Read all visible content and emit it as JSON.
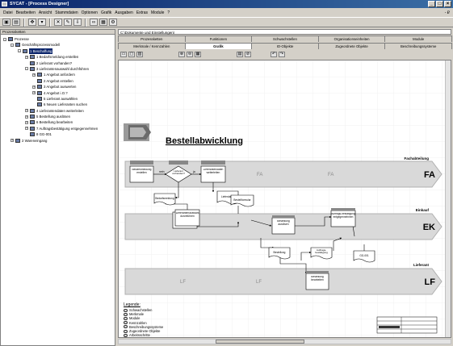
{
  "window": {
    "title": "SYCAT - [Process Designer]"
  },
  "menu": [
    "Datei",
    "Bearbeiten",
    "Ansicht",
    "Stammdaten",
    "Optionen",
    "Grafik",
    "Ausgaben",
    "Extras",
    "Module",
    "?"
  ],
  "menu_right": "- ₽",
  "left_pane": {
    "header": "Prozessketten",
    "tree": [
      {
        "label": "Prozesse",
        "level": 0,
        "box": "-"
      },
      {
        "label": "Geschäftsprozessmodell",
        "level": 1,
        "box": "-"
      },
      {
        "label": "1 Beschaffung",
        "level": 2,
        "box": "-",
        "selected": true
      },
      {
        "label": "1 Bedarfsmeldung erstellen",
        "level": 3,
        "box": "+"
      },
      {
        "label": "2 Lieferant vorhanden?",
        "level": 3,
        "box": ""
      },
      {
        "label": "3 Lieferantenauswahl durchführen",
        "level": 3,
        "box": "-"
      },
      {
        "label": "1 Angebot anfordern",
        "level": 4,
        "box": "+"
      },
      {
        "label": "2 Angebot erstellen",
        "level": 4,
        "box": ""
      },
      {
        "label": "3 Angebot auswerten",
        "level": 4,
        "box": "+"
      },
      {
        "label": "4 Angebot i.O.?",
        "level": 4,
        "box": "+"
      },
      {
        "label": "5 Lieferant auswählen",
        "level": 4,
        "box": ""
      },
      {
        "label": "6 Neuen Lieferanten suchen",
        "level": 4,
        "box": ""
      },
      {
        "label": "4 Lieferantendaten weiterleiten",
        "level": 3,
        "box": "+"
      },
      {
        "label": "5 Bestellung auslösen",
        "level": 3,
        "box": "+"
      },
      {
        "label": "6 Bestellung bearbeiten",
        "level": 3,
        "box": "+"
      },
      {
        "label": "7 Auftragsbestätigung entgegennehmen",
        "level": 3,
        "box": "+"
      },
      {
        "label": "8 GG-001",
        "level": 3,
        "box": ""
      },
      {
        "label": "2 Wareneingang",
        "level": 1,
        "box": "+"
      }
    ]
  },
  "path": "C:\\Dokumente und Einstellungen\\",
  "tabs_row1": [
    "Prozessketten",
    "Funktionen",
    "Schwachstellen",
    "Organisationseinheiten",
    "Module"
  ],
  "tabs_row2": [
    "Merkmale / Kennzahlen",
    "Grafik",
    "IO-Objekte",
    "Zugeordnete Objekte",
    "Beschreibungssysteme"
  ],
  "active_tab": "Grafik",
  "diagram": {
    "title": "Bestellabwicklung",
    "lanes": [
      {
        "name": "Fachabteilung",
        "code": "FA",
        "ghost": [
          "FA",
          "FA"
        ]
      },
      {
        "name": "Einkauf",
        "code": "EK",
        "ghost": []
      },
      {
        "name": "Lieferant",
        "code": "LF",
        "ghost": [
          "LF",
          "LF"
        ]
      }
    ],
    "boxes": {
      "bedarf": "Bedarfsmeldung erstellen",
      "liefvorh": "Lieferant vorhanden?",
      "liefdaten": "Lieferantendaten weiterleiten",
      "bestellung_ausl": "Bestellung auslösen",
      "liefausw": "Lieferantenauswahl durchführen",
      "auftragsb": "Auftrags-bestätigung entgegennehmen",
      "best_bearb": "Bestellung bearbeiten"
    },
    "docs": {
      "bedarfsmeldung": "Bedarfsmeldung",
      "lieferdaten": "Lieferdaten",
      "bestellformular": "Bestellformular",
      "bestellung": "Bestellung",
      "auftragsbest": "Auftrags-bestätigung",
      "gg": "GG-001"
    },
    "labels": {
      "nein": "nein",
      "ja": "ja"
    }
  },
  "legend": {
    "title": "Legende:",
    "items": [
      "Schwachstellen",
      "Merkmale",
      "Module",
      "Kennzahlen",
      "Beschreibungssysteme",
      "Zugeordnete Objekte",
      "Arbeitsschritte"
    ]
  }
}
